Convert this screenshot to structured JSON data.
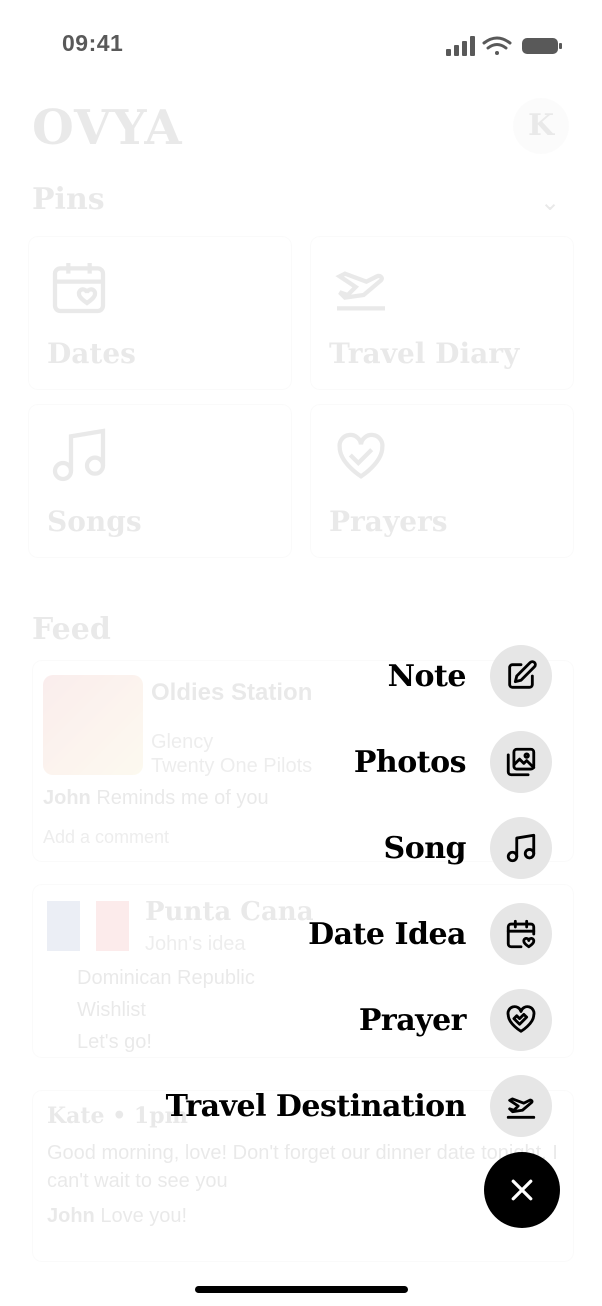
{
  "status_bar": {
    "time": "09:41"
  },
  "header": {
    "logo": "OVYA",
    "avatar_initial": "K"
  },
  "pins": {
    "title": "Pins",
    "items": [
      {
        "label": "Dates",
        "icon": "calendar-heart-icon"
      },
      {
        "label": "Travel Diary",
        "icon": "plane-takeoff-icon"
      },
      {
        "label": "Songs",
        "icon": "music-note-icon"
      },
      {
        "label": "Prayers",
        "icon": "hands-heart-icon"
      }
    ]
  },
  "feed": {
    "title": "Feed",
    "song_card": {
      "station": "Oldies Station",
      "track": "Glency",
      "artist": "Twenty One Pilots",
      "comment_author": "John",
      "comment_text": "Reminds me of you",
      "reply_placeholder": "Add a comment"
    },
    "travel_card": {
      "title": "Punta Cana",
      "subtitle": "John's idea",
      "country": "Dominican Republic",
      "status": "Wishlist",
      "note": "Let's go!"
    },
    "note_card": {
      "author_line": "Kate • 1pm",
      "body": "Good morning, love! Don't forget our dinner date tonight. I can't wait to see you",
      "reply_author": "John",
      "reply_text": "Love you!"
    }
  },
  "menu": {
    "items": [
      {
        "label": "Note",
        "icon": "edit-note-icon"
      },
      {
        "label": "Photos",
        "icon": "photos-icon"
      },
      {
        "label": "Song",
        "icon": "music-note-icon"
      },
      {
        "label": "Date Idea",
        "icon": "calendar-heart-icon"
      },
      {
        "label": "Prayer",
        "icon": "hands-heart-icon"
      },
      {
        "label": "Travel Destination",
        "icon": "plane-takeoff-icon"
      }
    ],
    "close_icon": "close-icon"
  },
  "colors": {
    "fab": "#000000",
    "menu_button_bg": "#e6e6e6",
    "text": "#000000"
  }
}
